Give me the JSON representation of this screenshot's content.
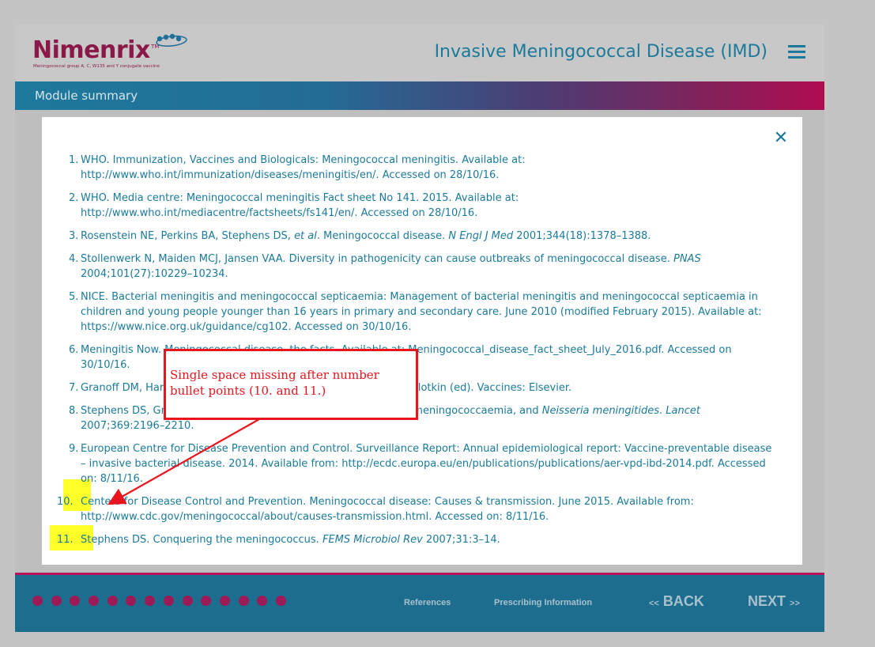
{
  "header": {
    "logo_word": "Nimenrix",
    "logo_tm": "TM",
    "logo_tagline": "Meningococcal group A, C, W135 and Y conjugate vaccine",
    "title": "Invasive Meningococcal Disease (IMD)",
    "menu_icon": "hamburger-menu-icon"
  },
  "subheader": {
    "label": "Module summary"
  },
  "modal": {
    "close_icon": "close-icon",
    "close_glyph": "✕",
    "references": [
      {
        "num": "1.",
        "text": "WHO. Immunization, Vaccines and Biologicals: Meningococcal meningitis. Available at: http://www.who.int/immunization/diseases/meningitis/en/. Accessed on 28/10/16."
      },
      {
        "num": "2.",
        "text": "WHO. Media centre: Meningococcal meningitis Fact sheet No 141. 2015. Available at: http://www.who.int/mediacentre/factsheets/fs141/en/. Accessed on 28/10/16."
      },
      {
        "num": "3.",
        "text_before": "Rosenstein NE, Perkins BA, Stephens DS, ",
        "italic1": "et al",
        "text_mid": ". Meningococcal disease. ",
        "italic2": "N Engl J Med",
        "text_after": " 2001;344(18):1378–1388."
      },
      {
        "num": "4.",
        "text_before": "Stollenwerk N, Maiden MCJ, Jansen VAA. Diversity in pathogenicity can cause outbreaks of meningococcal disease. ",
        "italic1": "PNAS",
        "text_after": " 2004;101(27):10229–10234."
      },
      {
        "num": "5.",
        "text": "NICE. Bacterial meningitis and meningococcal septicaemia: Management of bacterial meningitis and meningococcal septicaemia in children and young people younger than 16 years in primary and secondary care. June 2010 (modified February 2015). Available at: https://www.nice.org.uk/guidance/cg102. Accessed on 30/10/16."
      },
      {
        "num": "6.",
        "text": "Meningitis Now. Meningococcal disease, the facts. Available at: Meningococcal_disease_fact_sheet_July_2016.pdf. Accessed on 30/10/16."
      },
      {
        "num": "7.",
        "text": "Granoff DM, Harrison LH, Borrow R. Meningococcal vaccines. In: Plotkin (ed). Vaccines: Elsevier."
      },
      {
        "num": "8.",
        "text_before": "Stephens DS, Greenwood B, Brandtzaeg P. Epidemic meningitis, meningococcaemia, and ",
        "italic1": "Neisseria meningitides",
        "text_mid": ". ",
        "italic2": "Lancet",
        "text_after": " 2007;369:2196–2210."
      },
      {
        "num": "9.",
        "text": "European Centre for Disease Prevention and Control. Surveillance Report: Annual epidemiological report: Vaccine-preventable disease – invasive bacterial disease. 2014. Available from: http://ecdc.europa.eu/en/publications/publications/aer-vpd-ibd-2014.pdf. Accessed on: 8/11/16."
      },
      {
        "num": "10.",
        "text": "Centers for Disease Control and Prevention. Meningococcal disease: Causes & transmission. June 2015. Available from: http://www.cdc.gov/meningococcal/about/causes-transmission.html. Accessed on: 8/11/16."
      },
      {
        "num": "11.",
        "text_before": "Stephens DS. Conquering the meningococcus. ",
        "italic1": "FEMS Microbiol Rev",
        "text_after": " 2007;31:3–14."
      }
    ]
  },
  "annotation": {
    "callout_text": "Single space missing after number bullet points (10. and 11.)",
    "highlight_color": "#ffff2a",
    "callout_color": "#e8141e"
  },
  "footer": {
    "progress_dots": 14,
    "references_label": "References",
    "prescribing_label": "Prescribing Information",
    "back_chev": "<<",
    "back_label": "BACK",
    "next_label": "NEXT",
    "next_chev": ">>"
  },
  "colors": {
    "brand_magenta": "#8a1848",
    "teal_text": "#1b7a9a",
    "footer_bg": "#1d6e8e"
  }
}
